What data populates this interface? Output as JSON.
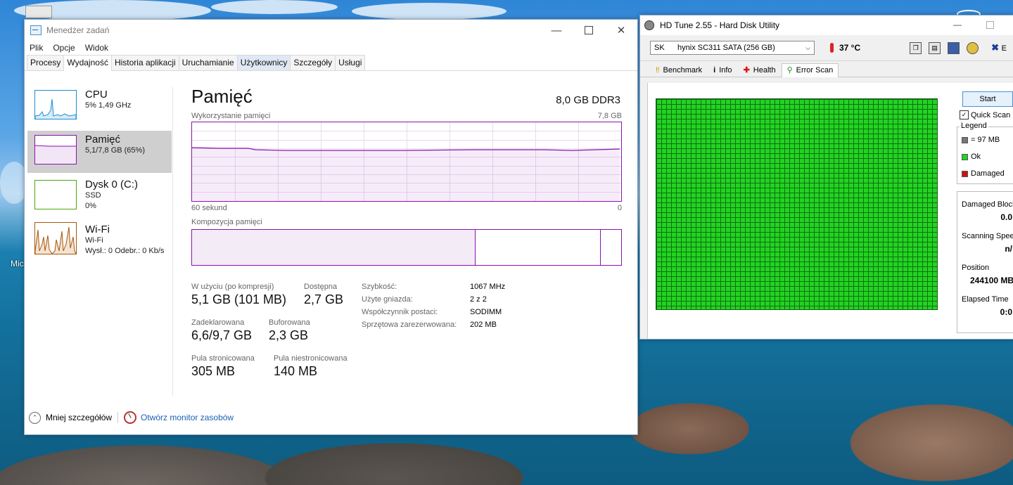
{
  "desktop": {
    "icon_label": "Mic"
  },
  "taskmanager": {
    "title": "Menedżer zadań",
    "menu": [
      "Plik",
      "Opcje",
      "Widok"
    ],
    "tabs": [
      "Procesy",
      "Wydajność",
      "Historia aplikacji",
      "Uruchamianie",
      "Użytkownicy",
      "Szczegóły",
      "Usługi"
    ],
    "sidebar": [
      {
        "title": "CPU",
        "line1": "5% 1,49 GHz",
        "line2": "",
        "color": "#1b8fd1"
      },
      {
        "title": "Pamięć",
        "line1": "5,1/7,8 GB (65%)",
        "line2": "",
        "color": "#8b12ae"
      },
      {
        "title": "Dysk 0 (C:)",
        "line1": "SSD",
        "line2": "0%",
        "color": "#4da60c"
      },
      {
        "title": "Wi-Fi",
        "line1": "Wi-Fi",
        "line2": "Wysł.: 0 Odebr.: 0 Kb/s",
        "color": "#a7570a"
      }
    ],
    "main": {
      "title": "Pamięć",
      "spec": "8,0 GB DDR3",
      "usage_label": "Wykorzystanie pamięci",
      "usage_max": "7,8 GB",
      "time_left": "60 sekund",
      "time_right": "0",
      "composition_label": "Kompozycja pamięci",
      "composition_in_use_fraction": 0.659,
      "composition_modified_fraction": 0.292,
      "stats": {
        "in_use_label": "W użyciu (po kompresji)",
        "in_use_value": "5,1 GB (101 MB)",
        "available_label": "Dostępna",
        "available_value": "2,7 GB",
        "committed_label": "Zadeklarowana",
        "committed_value": "6,6/9,7 GB",
        "cached_label": "Buforowana",
        "cached_value": "2,3 GB",
        "paged_label": "Pula stronicowana",
        "paged_value": "305 MB",
        "nonpaged_label": "Pula niestronicowana",
        "nonpaged_value": "140 MB"
      },
      "details": [
        {
          "k": "Szybkość:",
          "v": "1067 MHz"
        },
        {
          "k": "Użyte gniazda:",
          "v": "2 z 2"
        },
        {
          "k": "Współczynnik postaci:",
          "v": "SODIMM"
        },
        {
          "k": "Sprzętowa zarezerwowana:",
          "v": "202 MB"
        }
      ]
    },
    "footer": {
      "less_details": "Mniej szczegółów",
      "resource_monitor": "Otwórz monitor zasobów"
    }
  },
  "hdtune": {
    "title": "HD Tune 2.55 - Hard Disk Utility",
    "drive": "SK      hynix SC311 SATA (256 GB)",
    "temperature": "37 °C",
    "exit_label": "E",
    "tabs": [
      "Benchmark",
      "Info",
      "Health",
      "Error Scan"
    ],
    "start": "Start",
    "quick_scan": "Quick Scan",
    "legend_title": "Legend",
    "legend": [
      {
        "label": "= 97 MB",
        "color": "#777777"
      },
      {
        "label": "Ok",
        "color": "#21d421"
      },
      {
        "label": "Damaged",
        "color": "#cc1111"
      }
    ],
    "info": [
      {
        "label": "Damaged Blocks",
        "value": "0.0"
      },
      {
        "label": "Scanning Speed",
        "value": "n/"
      },
      {
        "label": "Position",
        "value": "244100 MB"
      },
      {
        "label": "Elapsed Time",
        "value": "0:0"
      }
    ]
  }
}
